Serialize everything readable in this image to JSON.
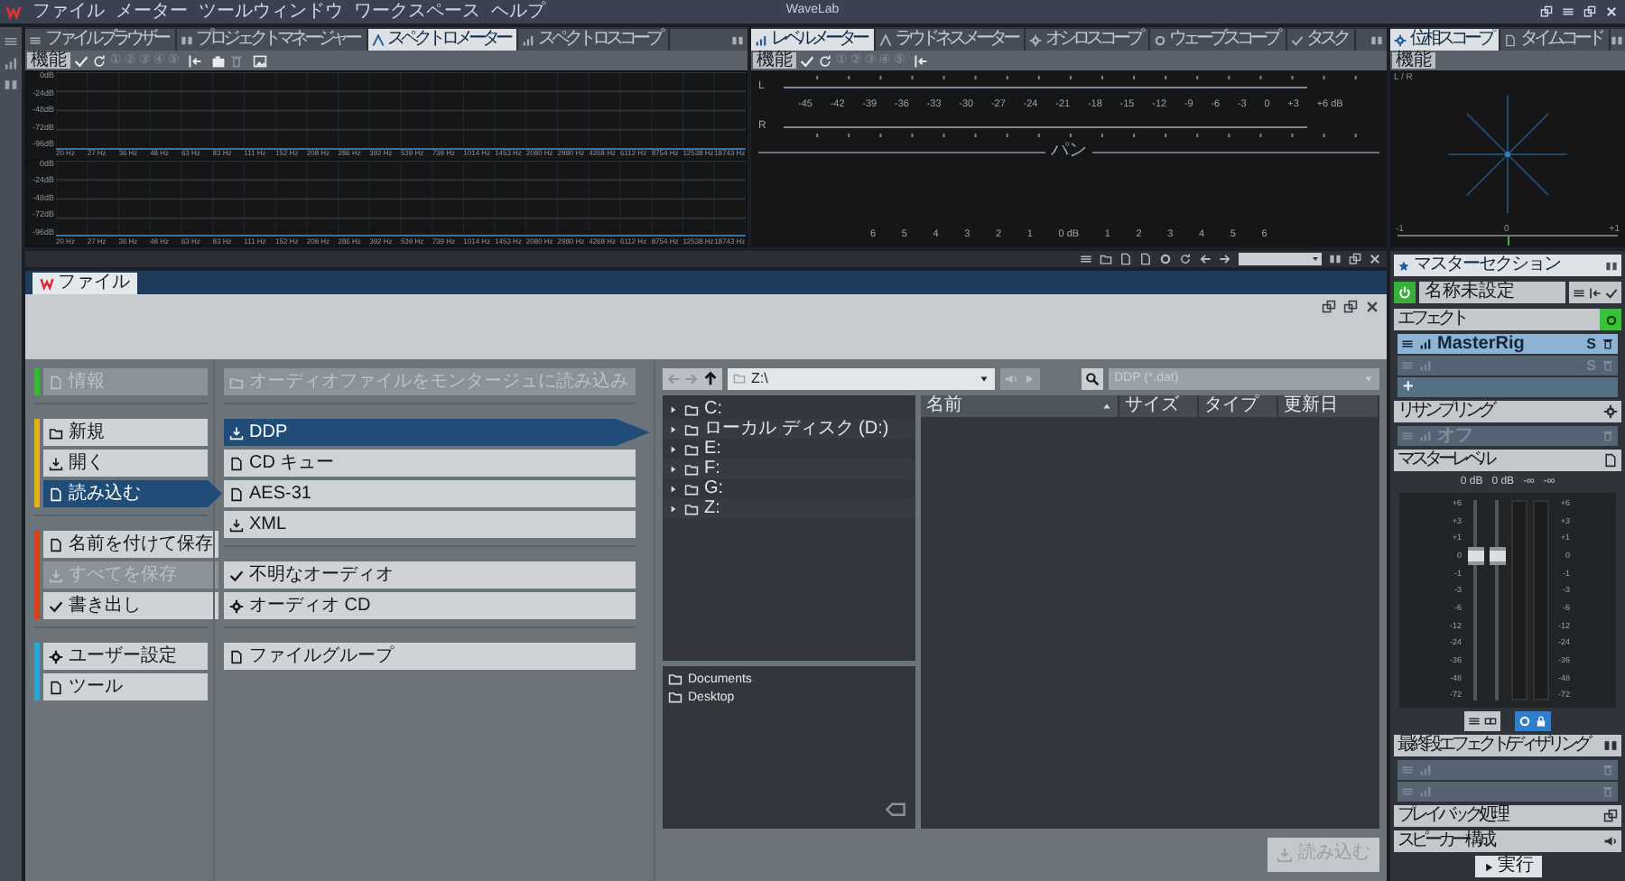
{
  "menu_bar": {
    "items": [
      "ファイル",
      "メーター",
      "ツールウィンドウ",
      "ワークスペース",
      "ヘルプ"
    ],
    "title": "WaveLab"
  },
  "spectrum_panel": {
    "tabs": [
      {
        "label": "ファイルブラウザー",
        "selected": false
      },
      {
        "label": "プロジェクトマネージャー",
        "selected": false
      },
      {
        "label": "スペクトロメーター",
        "selected": true
      },
      {
        "label": "スペクトロスコープ",
        "selected": false
      }
    ],
    "function_button": "機能",
    "preset_slots": [
      {
        "label": "①",
        "disabled": true
      },
      {
        "label": "②",
        "disabled": true
      },
      {
        "label": "③",
        "disabled": true
      },
      {
        "label": "④",
        "disabled": true
      },
      {
        "label": "⑤",
        "disabled": true
      }
    ],
    "graphs": [
      {
        "db_labels": [
          "0dB",
          "-24dB",
          "-48dB",
          "-72dB",
          "-96dB"
        ],
        "freq_labels": [
          "20 Hz",
          "27 Hz",
          "36 Hz",
          "48 Hz",
          "63 Hz",
          "83 Hz",
          "111 Hz",
          "152 Hz",
          "208 Hz",
          "286 Hz",
          "392 Hz",
          "539 Hz",
          "739 Hz",
          "1014 Hz",
          "1453 Hz",
          "2080 Hz",
          "2980 Hz",
          "4268 Hz",
          "6112 Hz",
          "8754 Hz",
          "12538 Hz",
          "18743 Hz"
        ]
      },
      {
        "db_labels": [
          "0dB",
          "-24dB",
          "-48dB",
          "-72dB",
          "-96dB"
        ],
        "freq_labels": [
          "20 Hz",
          "27 Hz",
          "36 Hz",
          "48 Hz",
          "63 Hz",
          "83 Hz",
          "111 Hz",
          "152 Hz",
          "208 Hz",
          "286 Hz",
          "392 Hz",
          "539 Hz",
          "739 Hz",
          "1014 Hz",
          "1453 Hz",
          "2080 Hz",
          "2980 Hz",
          "4268 Hz",
          "6112 Hz",
          "8754 Hz",
          "12538 Hz",
          "18743 Hz"
        ]
      }
    ]
  },
  "level_panel": {
    "tabs": [
      {
        "label": "レベルメーター",
        "selected": true
      },
      {
        "label": "ラウドネスメーター",
        "selected": false
      },
      {
        "label": "オシロスコープ",
        "selected": false
      },
      {
        "label": "ウェーブスコープ",
        "selected": false
      },
      {
        "label": "タスク",
        "selected": false
      }
    ],
    "function_button": "機能",
    "preset_slots": [
      {
        "label": "①",
        "disabled": true
      },
      {
        "label": "②",
        "disabled": true
      },
      {
        "label": "③",
        "disabled": true
      },
      {
        "label": "④",
        "disabled": true
      },
      {
        "label": "⑤",
        "disabled": true
      }
    ],
    "channels": [
      "L",
      "R"
    ],
    "scale_labels": [
      "-45",
      "-42",
      "-39",
      "-36",
      "-33",
      "-30",
      "-27",
      "-24",
      "-21",
      "-18",
      "-15",
      "-12",
      "-9",
      "-6",
      "-3",
      "0",
      "+3",
      "+6 dB"
    ],
    "pan_label": "パン",
    "pan_scale": [
      "6",
      "5",
      "4",
      "3",
      "2",
      "1",
      "0 dB",
      "1",
      "2",
      "3",
      "4",
      "5",
      "6"
    ]
  },
  "phase_panel": {
    "tabs": [
      {
        "label": "位相スコープ",
        "selected": true
      },
      {
        "label": "タイムコード",
        "selected": false
      }
    ],
    "function_button": "機能",
    "axis_label": "L / R",
    "scale": [
      "-1",
      "0",
      "+1"
    ]
  },
  "file_panel": {
    "tab": "ファイル",
    "groups": [
      {
        "color": "#2ec02e",
        "items": [
          {
            "label": "情報",
            "selected": false,
            "disabled": true
          }
        ]
      },
      {
        "color": "#e8b010",
        "items": [
          {
            "label": "新規",
            "selected": false,
            "disabled": false
          },
          {
            "label": "開く",
            "selected": false,
            "disabled": false
          },
          {
            "label": "読み込む",
            "selected": true,
            "disabled": false
          }
        ]
      },
      {
        "color": "#e04010",
        "items": [
          {
            "label": "名前を付けて保存",
            "selected": false,
            "disabled": false
          },
          {
            "label": "すべてを保存",
            "selected": false,
            "disabled": true
          },
          {
            "label": "書き出し",
            "selected": false,
            "disabled": false
          }
        ]
      },
      {
        "color": "#2aa8d8",
        "items": [
          {
            "label": "ユーザー設定",
            "selected": false,
            "disabled": false
          },
          {
            "label": "ツール",
            "selected": false,
            "disabled": false
          }
        ]
      }
    ],
    "formats": [
      {
        "items": [
          {
            "label": "オーディオファイルをモンタージュに読み込み",
            "selected": false,
            "disabled": true
          }
        ]
      },
      {
        "items": [
          {
            "label": "DDP",
            "selected": true,
            "disabled": false
          },
          {
            "label": "CD キュー",
            "selected": false,
            "disabled": false
          },
          {
            "label": "AES-31",
            "selected": false,
            "disabled": false
          },
          {
            "label": "XML",
            "selected": false,
            "disabled": false
          }
        ]
      },
      {
        "items": [
          {
            "label": "不明なオーディオ",
            "selected": false,
            "disabled": false
          },
          {
            "label": "オーディオ CD",
            "selected": false,
            "disabled": false
          }
        ]
      },
      {
        "items": [
          {
            "label": "ファイルグループ",
            "selected": false,
            "disabled": false
          }
        ]
      }
    ],
    "browser": {
      "path": "Z:\\",
      "filter": "DDP (*.dat)",
      "tree": [
        {
          "label": "C:",
          "expanded": false
        },
        {
          "label": "ローカル ディスク (D:)",
          "expanded": false
        },
        {
          "label": "E:",
          "expanded": false
        },
        {
          "label": "F:",
          "expanded": false
        },
        {
          "label": "G:",
          "expanded": false
        },
        {
          "label": "Z:",
          "expanded": false
        }
      ],
      "columns": [
        {
          "label": "名前",
          "sorted": true
        },
        {
          "label": "サイズ",
          "sorted": false
        },
        {
          "label": "タイプ",
          "sorted": false
        },
        {
          "label": "更新日",
          "sorted": false
        }
      ],
      "favorites": [
        "Documents",
        "Desktop"
      ],
      "load_button": {
        "label": "読み込む",
        "disabled": true
      }
    }
  },
  "master": {
    "title": "マスターセクション",
    "power_on": true,
    "preset": "名称未設定",
    "effects": {
      "title": "エフェクト",
      "on": true,
      "slots": [
        {
          "kind": "plugin",
          "label": "MasterRig",
          "solo": "S",
          "active": true
        },
        {
          "kind": "plugin",
          "solo": "S",
          "active": false
        },
        {
          "kind": "add",
          "label": "+"
        }
      ]
    },
    "resampling": {
      "title": "リサンプリング",
      "slots": [
        {
          "kind": "plugin",
          "label": "オフ",
          "active": false
        }
      ]
    },
    "level": {
      "title": "マスターレベル",
      "readings": [
        "0 dB",
        "0 dB",
        "-∞",
        "-∞"
      ],
      "scales": [
        {
          "labels": [
            "+6",
            "+3",
            "+1",
            "0",
            "-1",
            "-3",
            "-6",
            "-12",
            "-24",
            "-36",
            "-48",
            "-72"
          ]
        },
        {
          "labels": [
            "+6",
            "+3",
            "+1",
            "0",
            "-1",
            "-3",
            "-6",
            "-12",
            "-24",
            "-36",
            "-48",
            "-72"
          ]
        }
      ],
      "faders": [
        {
          "level": 0.72
        },
        {
          "level": 0.72
        }
      ]
    },
    "final_effects": {
      "title": "最終段エフェクト/ディザリング",
      "slots": [
        {
          "kind": "plugin",
          "active": false
        },
        {
          "kind": "plugin",
          "active": false
        }
      ]
    },
    "playback": "プレイバック処理",
    "speakers": "スピーカー構成",
    "render_button": "実行"
  }
}
